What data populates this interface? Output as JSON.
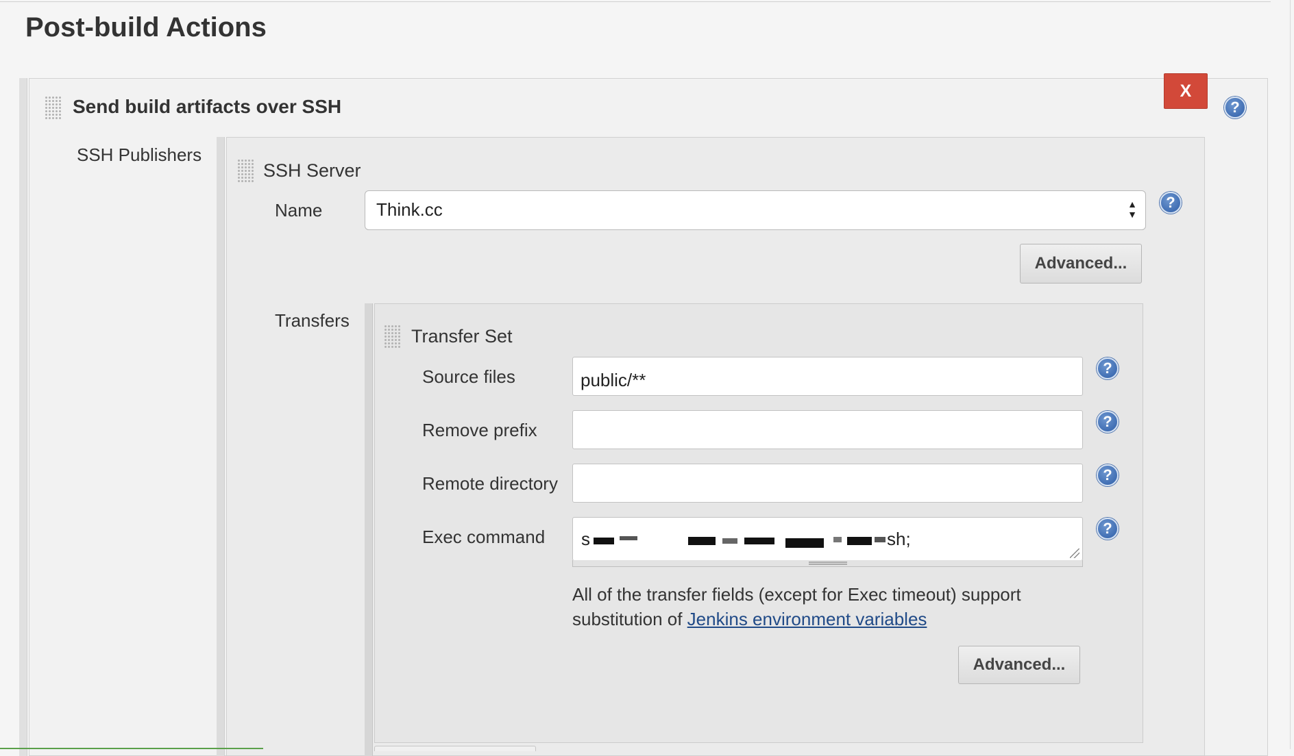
{
  "section": {
    "title": "Post-build Actions"
  },
  "publisher": {
    "title": "Send build artifacts over SSH",
    "delete_label": "X",
    "ssh_publishers_label": "SSH Publishers"
  },
  "help": {
    "glyph": "?"
  },
  "server": {
    "title": "SSH Server",
    "name_label": "Name",
    "name_value": "Think.cc",
    "advanced_label": "Advanced...",
    "transfers_label": "Transfers"
  },
  "transfer_set": {
    "title": "Transfer Set",
    "source_files_label": "Source files",
    "source_files_value": "public/**",
    "remove_prefix_label": "Remove prefix",
    "remove_prefix_value": "",
    "remote_directory_label": "Remote directory",
    "remote_directory_value": "",
    "exec_command_label": "Exec command",
    "exec_command_visible_prefix": "s",
    "exec_command_visible_suffix": "sh;",
    "note_text": "All of the transfer fields (except for Exec timeout) support substitution of",
    "note_link": "Jenkins environment variables",
    "advanced_label": "Advanced..."
  },
  "colors": {
    "delete_button": "#d24939",
    "help_icon": "#2e5ea8",
    "link": "#204a87"
  }
}
